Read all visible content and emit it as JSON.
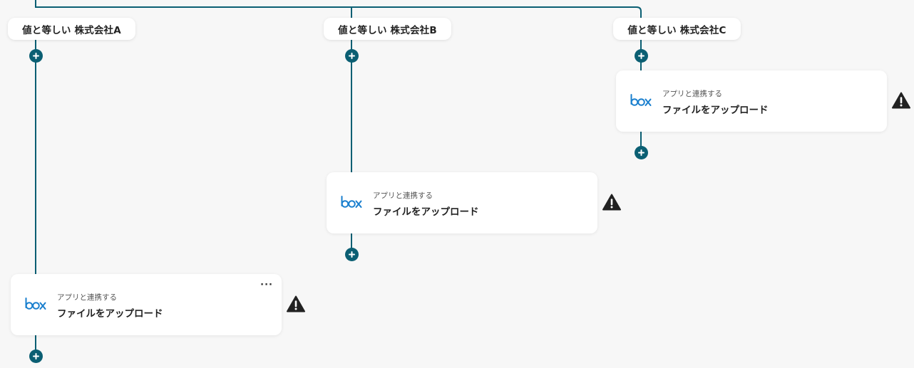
{
  "branches": [
    {
      "condition_label": "値と等しい 株式会社A"
    },
    {
      "condition_label": "値と等しい 株式会社B"
    },
    {
      "condition_label": "値と等しい 株式会社C"
    }
  ],
  "cards": [
    {
      "subtitle": "アプリと連携する",
      "title": "ファイルをアップロード",
      "more": "···",
      "icon": "box-logo"
    },
    {
      "subtitle": "アプリと連携する",
      "title": "ファイルをアップロード",
      "icon": "box-logo"
    },
    {
      "subtitle": "アプリと連携する",
      "title": "ファイルをアップロード",
      "icon": "box-logo"
    }
  ],
  "icons": {
    "add": "plus-icon",
    "warning": "warning-icon"
  },
  "colors": {
    "connector": "#0b5f73",
    "box_blue": "#1a7fce",
    "warning": "#222222"
  }
}
